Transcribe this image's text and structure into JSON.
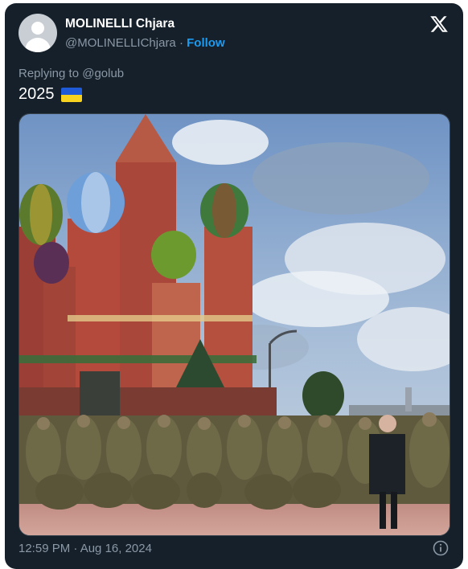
{
  "author": {
    "display_name": "MOLINELLI Chjara",
    "handle": "@MOLINELLIChjara",
    "separator": " · ",
    "follow_label": "Follow"
  },
  "reply": {
    "text": "Replying to @golub"
  },
  "tweet": {
    "text": "2025",
    "emoji": "ukraine-flag-emoji"
  },
  "media": {
    "type": "photo"
  },
  "meta": {
    "timestamp": "12:59 PM · Aug 16, 2024"
  },
  "icons": [
    "avatar-placeholder-icon",
    "x-logo-icon",
    "ukraine-flag-emoji",
    "info-icon"
  ],
  "colors": {
    "background": "#15202b",
    "text_primary": "#ffffff",
    "text_secondary": "#8b98a5",
    "accent": "#1d9bf0",
    "flag_blue": "#1f5bd6",
    "flag_yellow": "#f7d21e"
  }
}
